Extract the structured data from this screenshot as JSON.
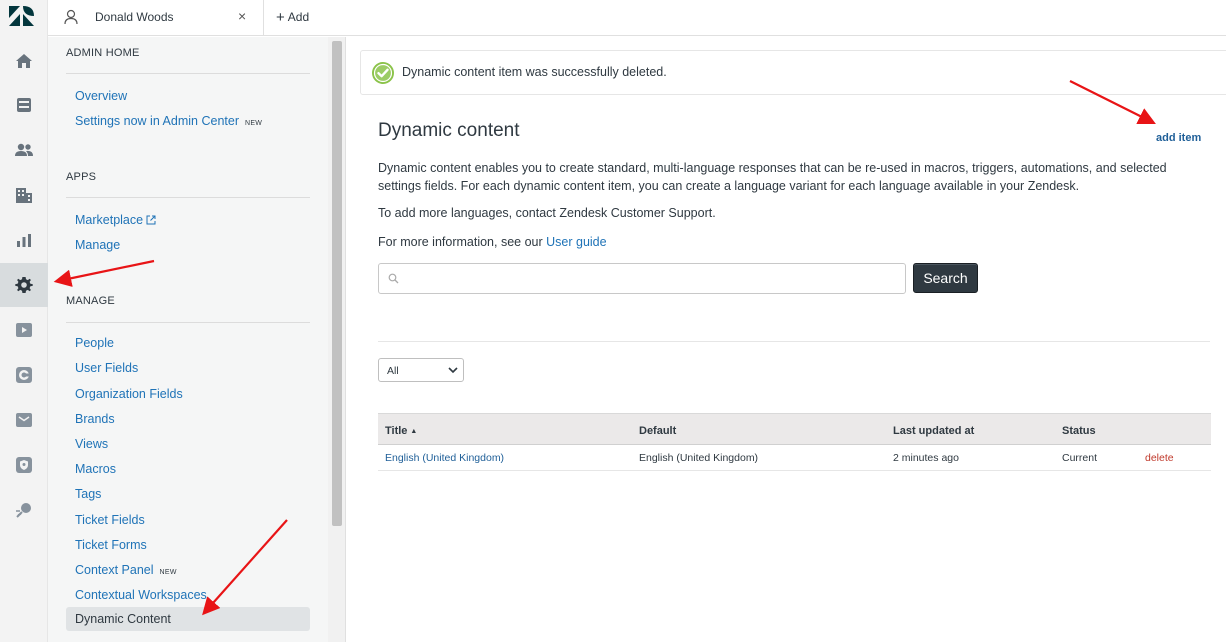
{
  "topbar": {
    "tab_label": "Donald Woods",
    "tab_close": "×",
    "add_label": "Add"
  },
  "rail": {
    "items": [
      "zendesk-logo",
      "home-icon",
      "views-icon",
      "customers-icon",
      "organizations-icon",
      "reporting-icon",
      "admin-gear-icon",
      "video-icon",
      "guide-icon",
      "mail-icon",
      "security-icon",
      "explore-icon"
    ],
    "active": "admin-gear-icon"
  },
  "sidebar": {
    "sections": [
      {
        "title": "ADMIN HOME",
        "links": [
          {
            "label": "Overview"
          },
          {
            "label": "Settings now in Admin Center",
            "badge": "NEW"
          }
        ]
      },
      {
        "title": "APPS",
        "links": [
          {
            "label": "Marketplace",
            "external": true
          },
          {
            "label": "Manage"
          }
        ]
      },
      {
        "title": "MANAGE",
        "links": [
          {
            "label": "People"
          },
          {
            "label": "User Fields"
          },
          {
            "label": "Organization Fields"
          },
          {
            "label": "Brands"
          },
          {
            "label": "Views"
          },
          {
            "label": "Macros"
          },
          {
            "label": "Tags"
          },
          {
            "label": "Ticket Fields"
          },
          {
            "label": "Ticket Forms"
          },
          {
            "label": "Context Panel",
            "badge": "NEW"
          },
          {
            "label": "Contextual Workspaces"
          }
        ]
      }
    ],
    "active_item": "Dynamic Content"
  },
  "notice": {
    "text": "Dynamic content item was successfully deleted."
  },
  "main": {
    "title": "Dynamic content",
    "add_item": "add item",
    "description": "Dynamic content enables you to create standard, multi-language responses that can be re-used in macros, triggers, automations, and selected settings fields. For each dynamic content item, you can create a language variant for each language available in your Zendesk.",
    "languages_note": "To add more languages, contact Zendesk Customer Support.",
    "more_info_prefix": "For more information, see our",
    "user_guide_link": "User guide",
    "search_placeholder": "",
    "search_button": "Search",
    "filter_value": "All"
  },
  "table": {
    "columns": [
      "Title",
      "Default",
      "Last updated at",
      "Status"
    ],
    "rows": [
      {
        "title": "English (United Kingdom)",
        "default": "English (United Kingdom)",
        "updated": "2 minutes ago",
        "status": "Current",
        "action": "delete"
      }
    ]
  },
  "colors": {
    "link": "#1f73b7",
    "accent_dark": "#2f3941",
    "success": "#8bc34a",
    "delete": "#c0392b",
    "annotation": "#e81416"
  }
}
